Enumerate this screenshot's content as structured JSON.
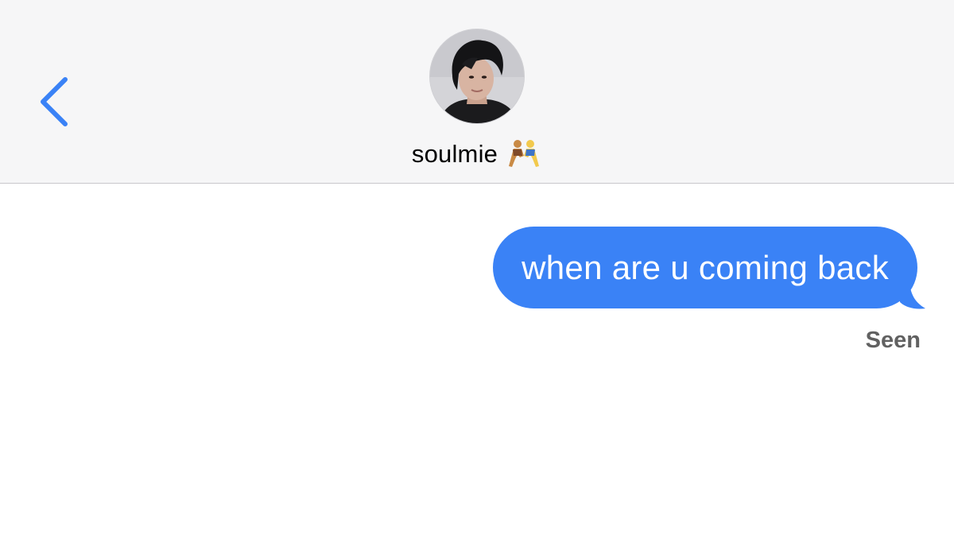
{
  "header": {
    "back_icon": "chevron-left-icon",
    "contact_name": "soulmie",
    "avatar_icon": "profile-photo",
    "name_emoji": "people-wrestling-emoji"
  },
  "conversation": {
    "messages": [
      {
        "text": "when are u coming back",
        "direction": "outgoing"
      }
    ],
    "status": "Seen"
  },
  "colors": {
    "accent": "#3a82f6",
    "header_bg": "#f6f6f7",
    "status_text": "#616161"
  }
}
